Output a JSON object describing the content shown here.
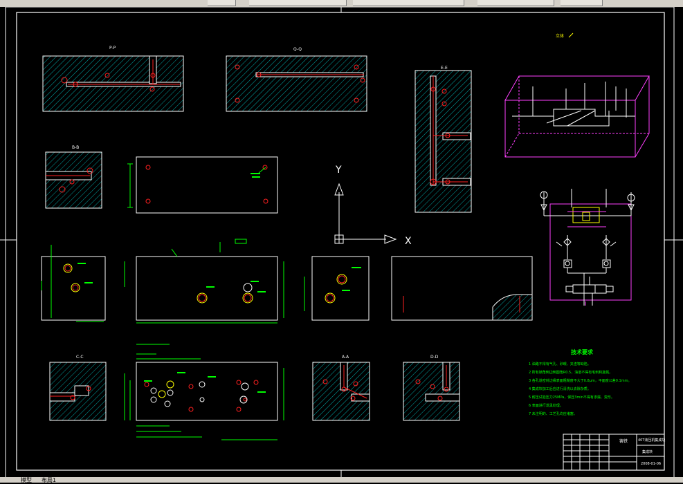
{
  "toolbar": {
    "partial_label": "..."
  },
  "drawing": {
    "section_labels": {
      "pp": "P-P",
      "qq": "Q-Q",
      "ee": "E-E",
      "bb": "B-B",
      "cc": "C-C",
      "aa": "A-A",
      "dd": "D-D"
    },
    "axis_y": "Y",
    "axis_x": "X",
    "iso_label": "立体",
    "tech_title": "技术要求",
    "tech_items": [
      "1 油路不得有气孔、砂眼、夹渣等缺陷。",
      "2 所有锁角倒边倒圆角R0.5，油道不得有毛刺和旋属。",
      "3 各孔道密封边缘表面粗糙度不大于0.8μm，平面度公差0.1mm。",
      "4 集成块加工后应进行清洗以去除杂质。",
      "5 耐压试验压力25MPa，保压3min不得有渗漏、变形。",
      "6 表面进行发黑处理。",
      "7 未注明的、工艺孔均应堵塞。"
    ],
    "title_block": {
      "name": "40T液压机集成块",
      "material": "铸铁",
      "drawing_no": "集成块",
      "date": "2008-01-06"
    }
  },
  "status": {
    "model_tab": "模型",
    "layout_tab": "布局1"
  },
  "colors": {
    "bg": "#000000",
    "line": "#ffffff",
    "hatch": "#00a8a8",
    "red": "#ff2020",
    "green": "#00ff00",
    "magenta": "#ff40ff",
    "yellow": "#ffff00"
  }
}
